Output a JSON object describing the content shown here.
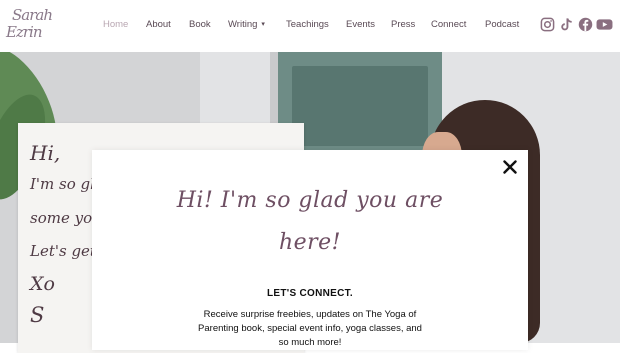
{
  "logo": {
    "line1": "Sarah",
    "line2": "Ezrin"
  },
  "nav": {
    "items": [
      {
        "label": "Home",
        "active": true
      },
      {
        "label": "About"
      },
      {
        "label": "Book"
      },
      {
        "label": "Writing",
        "dropdown": true
      },
      {
        "label": "Teachings"
      },
      {
        "label": "Events"
      },
      {
        "label": "Press"
      },
      {
        "label": "Connect"
      },
      {
        "label": "Podcast"
      }
    ],
    "caret": "▾"
  },
  "social": [
    {
      "icon": "instagram-icon"
    },
    {
      "icon": "tiktok-icon"
    },
    {
      "icon": "facebook-icon"
    },
    {
      "icon": "youtube-icon"
    }
  ],
  "colors": {
    "accent": "#6e4f63",
    "nav_text": "#5a4a55",
    "nav_active": "#b9a7b2",
    "social": "#8a6f80"
  },
  "note": {
    "lines": [
      "Hi,",
      "I'm so glad",
      "some yoga. (",
      "Let's get real",
      "Xo",
      "S"
    ]
  },
  "popup": {
    "headline_line1": "Hi! I'm so glad you are",
    "headline_line2": "here!",
    "cta": "LET'S CONNECT.",
    "body": "Receive surprise freebies, updates on The Yoga of Parenting book, special event info, yoga classes, and so much more!"
  }
}
